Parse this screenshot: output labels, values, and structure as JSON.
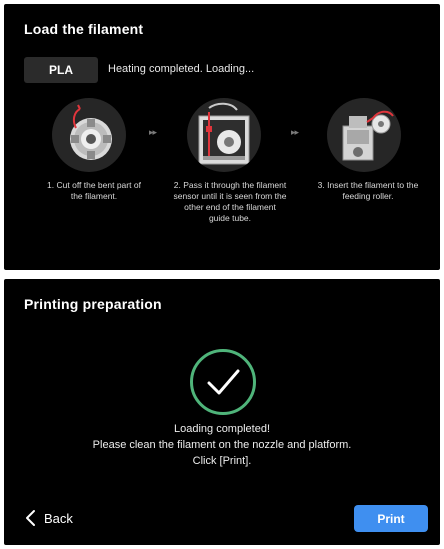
{
  "load_panel": {
    "title": "Load the filament",
    "material_badge": "PLA",
    "status": "Heating completed. Loading...",
    "arrow": "▸▸",
    "steps": [
      {
        "caption_lines": [
          "1. Cut off the bent part  of",
          "the filament."
        ]
      },
      {
        "caption_lines": [
          "2. Pass it through the filament",
          "sensor until it is seen from the",
          "other end of the filament",
          "guide tube."
        ]
      },
      {
        "caption_lines": [
          "3. Insert the filament to the",
          "feeding roller."
        ]
      }
    ]
  },
  "prep_panel": {
    "title": "Printing preparation",
    "check_color": "#4fb47a",
    "message_lines": [
      "Loading completed!",
      "Please clean the filament on the nozzle and platform.",
      "Click [Print]."
    ],
    "back_label": "Back",
    "print_label": "Print",
    "print_color": "#3f8ff0"
  }
}
